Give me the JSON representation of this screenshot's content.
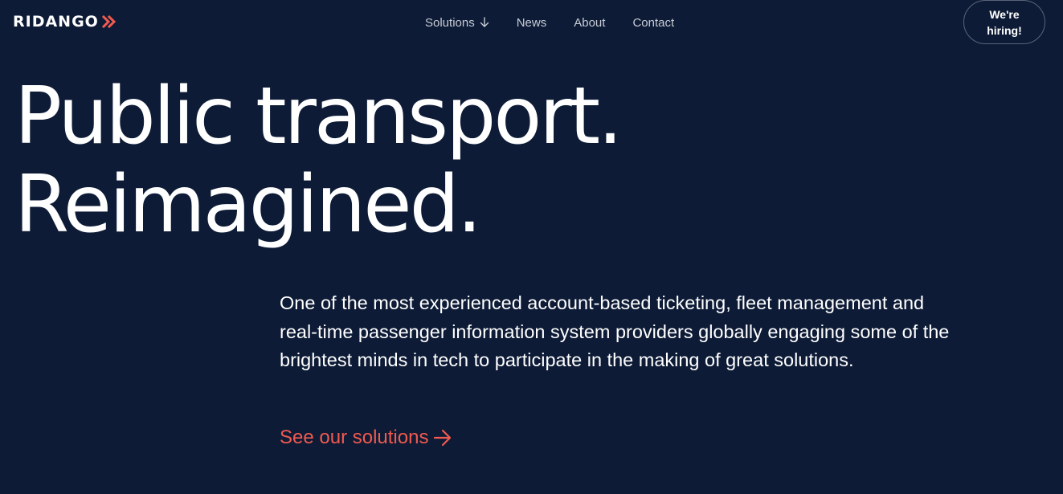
{
  "header": {
    "logo_text": "RIDANGO",
    "logo_mark_icon": "double-chevron-right-icon",
    "nav": [
      {
        "label": "Solutions",
        "icon": "arrow-down-icon"
      },
      {
        "label": "News"
      },
      {
        "label": "About"
      },
      {
        "label": "Contact"
      }
    ],
    "hiring_label": "We're hiring!"
  },
  "hero": {
    "title_line1": "Public transport.",
    "title_line2": "Reimagined.",
    "description": "One of the most experienced account-based ticketing, fleet management and real-time passenger information system providers globally engaging some of the brightest minds in tech to participate in the making of great solutions.",
    "cta_label": "See our solutions",
    "cta_icon": "arrow-right-icon"
  },
  "colors": {
    "background": "#0d1b36",
    "accent": "#f05a4f",
    "nav_text": "#c7ccd6",
    "text": "#ffffff"
  }
}
